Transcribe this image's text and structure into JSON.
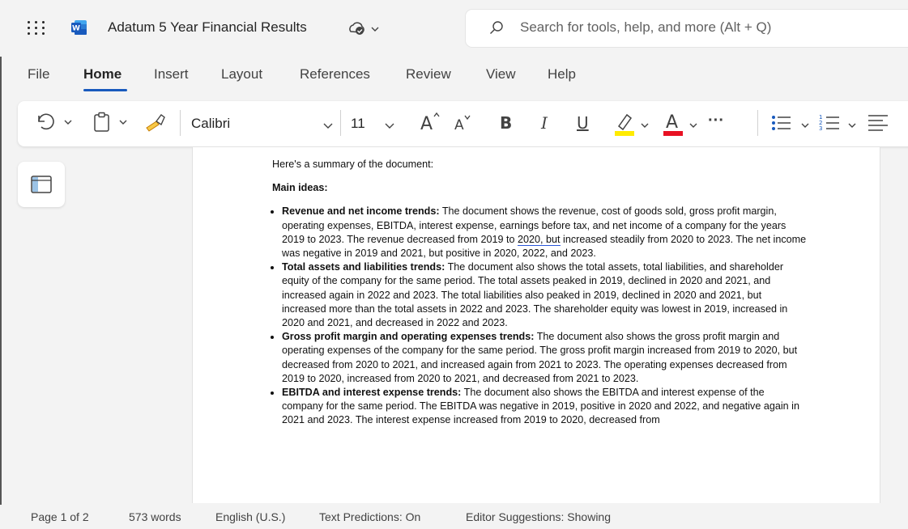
{
  "app": {
    "document_title": "Adatum 5 Year Financial Results",
    "search_placeholder": "Search for tools, help, and more (Alt + Q)"
  },
  "tabs": [
    {
      "label": "File"
    },
    {
      "label": "Home"
    },
    {
      "label": "Insert"
    },
    {
      "label": "Layout"
    },
    {
      "label": "References"
    },
    {
      "label": "Review"
    },
    {
      "label": "View"
    },
    {
      "label": "Help"
    }
  ],
  "ribbon": {
    "font_name": "Calibri",
    "font_size": "11",
    "bold": "B",
    "italic": "I",
    "underline": "U",
    "more": "···",
    "highlight_color": "#ffeb00",
    "font_color": "#e81123"
  },
  "document": {
    "intro": "Here's a summary of the document:",
    "heading": "Main ideas:",
    "bullets": [
      {
        "title": "Revenue and net income trends:",
        "text_a": " The document shows the revenue, cost of goods sold, gross profit margin, operating expenses, EBITDA, interest expense, earnings before tax, and net income of a company for the years 2019 to 2023. The revenue decreased from 2019 to ",
        "flagged": "2020, but",
        "text_b": " increased steadily from 2020 to 2023. The net income was negative in 2019 and 2021, but positive in 2020, 2022, and 2023."
      },
      {
        "title": "Total assets and liabilities trends:",
        "text": " The document also shows the total assets, total liabilities, and shareholder equity of the company for the same period. The total assets peaked in 2019, declined in 2020 and 2021, and increased again in 2022 and 2023. The total liabilities also peaked in 2019, declined in 2020 and 2021, but increased more than the total assets in 2022 and 2023. The shareholder equity was lowest in 2019, increased in 2020 and 2021, and decreased in 2022 and 2023."
      },
      {
        "title": "Gross profit margin and operating expenses trends:",
        "text": " The document also shows the gross profit margin and operating expenses of the company for the same period. The gross profit margin increased from 2019 to 2020, but decreased from 2020 to 2021, and increased again from 2021 to 2023. The operating expenses decreased from 2019 to 2020, increased from 2020 to 2021, and decreased from 2021 to 2023."
      },
      {
        "title": "EBITDA and interest expense trends:",
        "text": " The document also shows the EBITDA and interest expense of the company for the same period. The EBITDA was negative in 2019, positive in 2020 and 2022, and negative again in 2021 and 2023. The interest expense increased from 2019 to 2020, decreased from"
      }
    ]
  },
  "status": {
    "page": "Page 1 of 2",
    "words": "573 words",
    "language": "English (U.S.)",
    "predictions": "Text Predictions: On",
    "suggestions": "Editor Suggestions: Showing"
  }
}
